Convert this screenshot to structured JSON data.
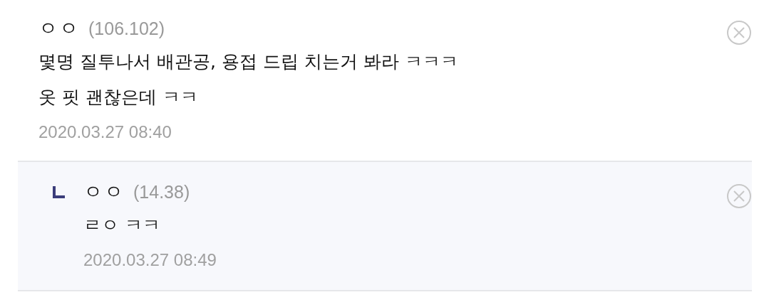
{
  "comments": [
    {
      "kind": "comment",
      "author": "ㅇㅇ",
      "ip": "(106.102)",
      "lines": [
        "몇명 질투나서 배관공, 용접 드립 치는거 봐라 ㅋㅋㅋ",
        "옷 핏 괜찮은데 ㅋㅋ"
      ],
      "date": "2020.03.27 08:40"
    },
    {
      "kind": "reply",
      "author": "ㅇㅇ",
      "ip": "(14.38)",
      "lines": [
        "ㄹㅇ ㅋㅋ"
      ],
      "date": "2020.03.27 08:49"
    }
  ]
}
